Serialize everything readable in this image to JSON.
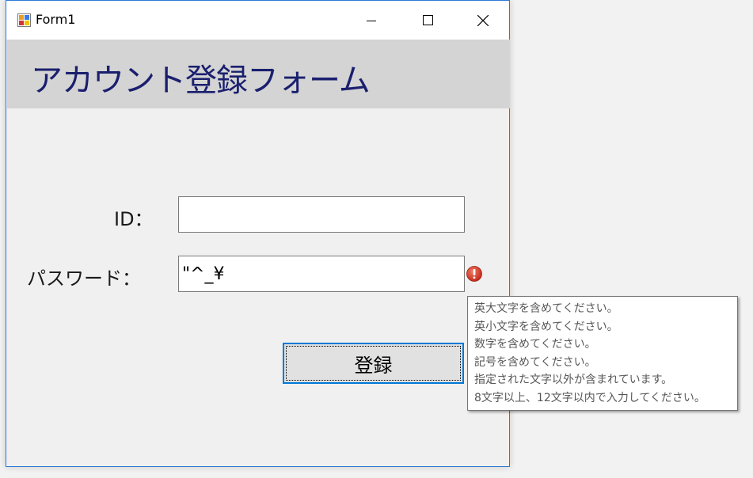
{
  "window": {
    "title": "Form1"
  },
  "header": {
    "title": "アカウント登録フォーム"
  },
  "form": {
    "id_label": "ID：",
    "id_value": "",
    "password_label": "パスワード：",
    "password_value": "\"^_¥",
    "submit_label": "登録"
  },
  "validation": {
    "messages": [
      "英大文字を含めてください。",
      "英小文字を含めてください。",
      "数字を含めてください。",
      "記号を含めてください。",
      "指定された文字以外が含まれています。",
      "8文字以上、12文字以内で入力してください。"
    ]
  },
  "colors": {
    "header_band": "#d4d4d4",
    "header_text": "#1a1f6e",
    "window_border": "#2b7bd6",
    "error_icon": "#d93a2b",
    "focus_border": "#0078d7"
  }
}
